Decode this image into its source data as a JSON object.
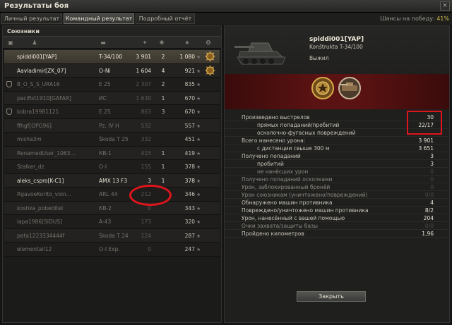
{
  "window": {
    "title": "Результаты боя",
    "close_glyph": "×"
  },
  "tabs": [
    {
      "label": "Личный результат",
      "active": false
    },
    {
      "label": "Командный результат",
      "active": true
    },
    {
      "label": "Подробный отчёт",
      "active": false
    }
  ],
  "victory": {
    "label": "Шансы на победу:",
    "value": "41%"
  },
  "team": {
    "heading": "Союзники",
    "players": [
      {
        "name": "spiddi001[YAP]",
        "tank": "T-34/100",
        "damage": "3 901",
        "frags": "2",
        "xp": "1 080",
        "alive": true,
        "me": true,
        "medal": true
      },
      {
        "name": "Aavladimir[ZK_07]",
        "tank": "O-Ni",
        "damage": "1 604",
        "frags": "4",
        "xp": "921",
        "alive": true,
        "medal": true
      },
      {
        "name": "B_O_S_S_URA16",
        "tank": "E 25",
        "damage": "2 307",
        "frags": "2",
        "xp": "835",
        "alive": false,
        "clan_icon": true
      },
      {
        "name": "pacifist1910[GAFAR]",
        "tank": "ИС",
        "damage": "1 630",
        "frags": "1",
        "xp": "670",
        "alive": false
      },
      {
        "name": "kobra19981121",
        "tank": "E 25",
        "damage": "863",
        "frags": "3",
        "xp": "670",
        "alive": false,
        "clan_icon": true
      },
      {
        "name": "ffhgf[OPG96]",
        "tank": "Pz. IV H",
        "damage": "532",
        "frags": "",
        "xp": "557",
        "alive": false
      },
      {
        "name": "misha3m",
        "tank": "Škoda T 25",
        "damage": "332",
        "frags": "",
        "xp": "451",
        "alive": false
      },
      {
        "name": "RenamedUser_1063...",
        "tank": "КВ-1",
        "damage": "415",
        "frags": "1",
        "xp": "419",
        "alive": false
      },
      {
        "name": "Stalker_dz",
        "tank": "O-I",
        "damage": "155",
        "frags": "1",
        "xp": "378",
        "alive": false
      },
      {
        "name": "aleks_cspro[K-C1]",
        "tank": "AMX 13 F3",
        "damage": "3",
        "frags": "1",
        "xp": "378",
        "alive": true
      },
      {
        "name": "RgavoeKorito_voin...",
        "tank": "ARL 44",
        "damage": "212",
        "frags": "",
        "xp": "346",
        "alive": false
      },
      {
        "name": "koshka_pobeditel",
        "tank": "КВ-2",
        "damage": "0",
        "frags": "",
        "xp": "343",
        "alive": false
      },
      {
        "name": "lapa1986[SIDUS]",
        "tank": "A-43",
        "damage": "173",
        "frags": "",
        "xp": "320",
        "alive": false
      },
      {
        "name": "peta1223334444f",
        "tank": "Škoda T 24",
        "damage": "124",
        "frags": "",
        "xp": "287",
        "alive": false
      },
      {
        "name": "elementail12",
        "tank": "O-I Exp.",
        "damage": "0",
        "frags": "",
        "xp": "247",
        "alive": false
      }
    ]
  },
  "player": {
    "name": "spiddi001[YAP]",
    "tank": "Konštrukta T-34/100",
    "status": "Выжил",
    "stats": [
      {
        "label": "Произведено выстрелов",
        "value": "30",
        "sub": false
      },
      {
        "label": "прямых попаданий/пробитий",
        "value": "22/17",
        "sub": true
      },
      {
        "label": "осколочно-фугасных повреждений",
        "value": "",
        "sub": true
      },
      {
        "label": "Всего нанесено урона:",
        "value": "3 901",
        "sub": false
      },
      {
        "label": "с дистанции свыше 300 м",
        "value": "3 651",
        "sub": true
      },
      {
        "label": "Получено попаданий",
        "value": "3",
        "sub": false
      },
      {
        "label": "пробитий",
        "value": "3",
        "sub": true
      },
      {
        "label": "не нанёсших урон",
        "value": "0",
        "sub": true,
        "zero": true
      },
      {
        "label": "Получено попаданий осколками",
        "value": "0",
        "sub": false,
        "zero": true
      },
      {
        "label": "Урон, заблокированный бронёй",
        "value": "0",
        "sub": false,
        "zero": true
      },
      {
        "label": "Урон союзникам (уничтожено/повреждений)",
        "value": "0/0",
        "sub": false,
        "zero": true
      },
      {
        "label": "Обнаружено машин противника",
        "value": "4",
        "sub": false
      },
      {
        "label": "Повреждено/уничтожено машин противника",
        "value": "8/2",
        "sub": false
      },
      {
        "label": "Урон, нанесённый с вашей помощью",
        "value": "204",
        "sub": false
      },
      {
        "label": "Очки захвата/защиты базы",
        "value": "0/0",
        "sub": false,
        "zero": true
      },
      {
        "label": "Пройдено километров",
        "value": "1,96",
        "sub": false
      }
    ]
  },
  "close_button": "Закрыть",
  "colors": {
    "accent_gold": "#d4c04a",
    "highlight_red": "#e0141c"
  }
}
